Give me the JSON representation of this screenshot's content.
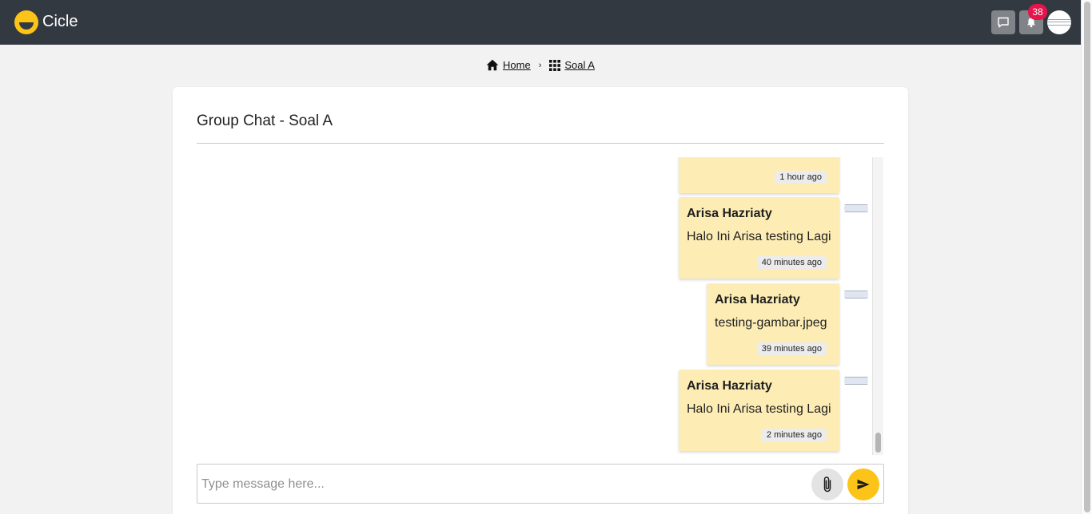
{
  "app": {
    "name": "Cicle",
    "brand_color": "#fcc419",
    "topbar_color": "#333941"
  },
  "topbar": {
    "chat_icon": "chat-bubble-icon",
    "notification_icon": "bell-icon",
    "notification_count": "38",
    "badge_color": "#e8134a"
  },
  "breadcrumb": {
    "items": [
      {
        "label": "Home",
        "icon": "home-icon"
      },
      {
        "label": "Soal A",
        "icon": "grid-icon"
      }
    ],
    "separator": "›"
  },
  "chat": {
    "title": "Group Chat - Soal A",
    "bubble_color": "#fdedb5",
    "messages": [
      {
        "sender": "",
        "text": "",
        "time": "1 hour ago"
      },
      {
        "sender": "Arisa Hazriaty",
        "text": "Halo Ini Arisa testing Lagi",
        "time": "40 minutes ago"
      },
      {
        "sender": "Arisa Hazriaty",
        "text": "testing-gambar.jpeg",
        "time": "39 minutes ago"
      },
      {
        "sender": "Arisa Hazriaty",
        "text": "Halo Ini Arisa testing Lagi",
        "time": "2 minutes ago"
      }
    ]
  },
  "composer": {
    "placeholder": "Type message here...",
    "value": "",
    "attach_icon": "paperclip-icon",
    "send_icon": "send-icon"
  }
}
